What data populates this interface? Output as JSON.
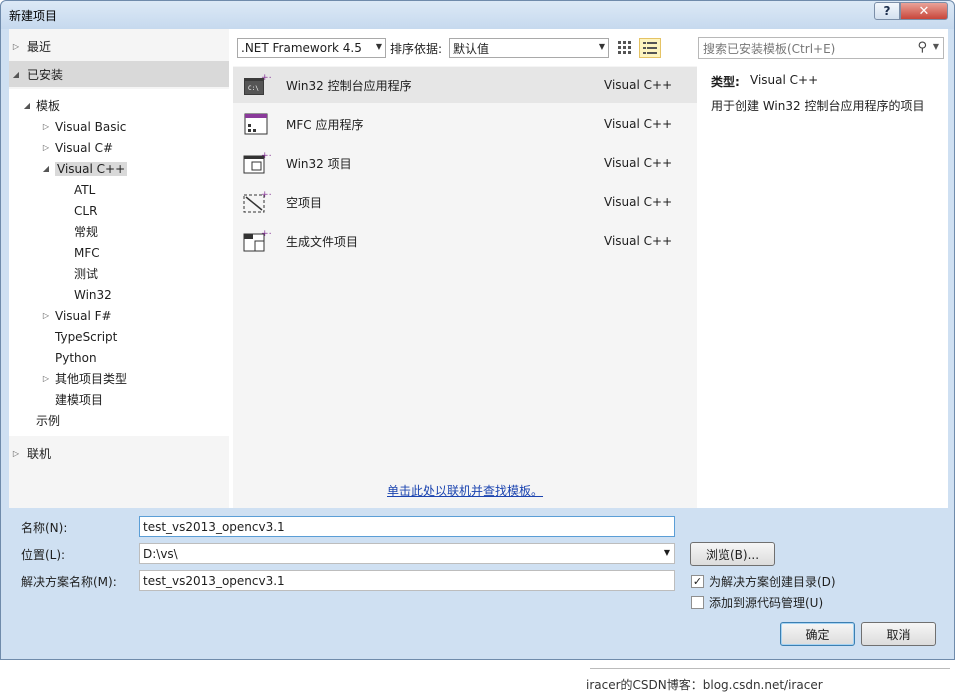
{
  "window": {
    "title": "新建项目",
    "help_label": "?",
    "close_label": "✕"
  },
  "left": {
    "recent_label": "最近",
    "installed_label": "已安装",
    "online_label": "联机",
    "tree": [
      {
        "label": "模板",
        "level": 0,
        "expander": "expanded",
        "selected": false
      },
      {
        "label": "Visual Basic",
        "level": 1,
        "expander": "collapsed",
        "selected": false
      },
      {
        "label": "Visual C#",
        "level": 1,
        "expander": "collapsed",
        "selected": false
      },
      {
        "label": "Visual C++",
        "level": 1,
        "expander": "expanded",
        "selected": true
      },
      {
        "label": "ATL",
        "level": 2,
        "expander": "none",
        "selected": false
      },
      {
        "label": "CLR",
        "level": 2,
        "expander": "none",
        "selected": false
      },
      {
        "label": "常规",
        "level": 2,
        "expander": "none",
        "selected": false
      },
      {
        "label": "MFC",
        "level": 2,
        "expander": "none",
        "selected": false
      },
      {
        "label": "测试",
        "level": 2,
        "expander": "none",
        "selected": false
      },
      {
        "label": "Win32",
        "level": 2,
        "expander": "none",
        "selected": false
      },
      {
        "label": "Visual F#",
        "level": 1,
        "expander": "collapsed",
        "selected": false
      },
      {
        "label": "TypeScript",
        "level": 1,
        "expander": "none",
        "selected": false
      },
      {
        "label": "Python",
        "level": 1,
        "expander": "none",
        "selected": false
      },
      {
        "label": "其他项目类型",
        "level": 1,
        "expander": "collapsed",
        "selected": false
      },
      {
        "label": "建模项目",
        "level": 1,
        "expander": "none",
        "selected": false
      },
      {
        "label": "示例",
        "level": 0,
        "expander": "none",
        "selected": false
      }
    ]
  },
  "toolbar": {
    "framework": ".NET Framework 4.5",
    "sort_label": "排序依据:",
    "sort_value": "默认值",
    "search_placeholder": "搜索已安装模板(Ctrl+E)"
  },
  "templates": [
    {
      "name": "Win32 控制台应用程序",
      "lang": "Visual C++",
      "icon": "console-app-icon",
      "selected": true
    },
    {
      "name": "MFC 应用程序",
      "lang": "Visual C++",
      "icon": "mfc-app-icon",
      "selected": false
    },
    {
      "name": "Win32 项目",
      "lang": "Visual C++",
      "icon": "win32-project-icon",
      "selected": false
    },
    {
      "name": "空项目",
      "lang": "Visual C++",
      "icon": "empty-project-icon",
      "selected": false
    },
    {
      "name": "生成文件项目",
      "lang": "Visual C++",
      "icon": "makefile-project-icon",
      "selected": false
    }
  ],
  "online_link": "单击此处以联机并查找模板。",
  "details": {
    "type_label": "类型:",
    "type_value": "Visual C++",
    "description": "用于创建 Win32 控制台应用程序的项目"
  },
  "form": {
    "name_label": "名称(N):",
    "name_value": "test_vs2013_opencv3.1",
    "location_label": "位置(L):",
    "location_value": "D:\\vs\\",
    "solution_label": "解决方案名称(M):",
    "solution_value": "test_vs2013_opencv3.1",
    "browse_label": "浏览(B)...",
    "create_dir_label": "为解决方案创建目录(D)",
    "create_dir_checked": true,
    "source_control_label": "添加到源代码管理(U)",
    "source_control_checked": false,
    "ok_label": "确定",
    "cancel_label": "取消"
  },
  "watermark": "iracer的CSDN博客：blog.csdn.net/iracer",
  "colors": {
    "dialog_bg": "#cfe0f2",
    "selected_bg": "#d9d9d9",
    "link": "#1b44b0"
  }
}
